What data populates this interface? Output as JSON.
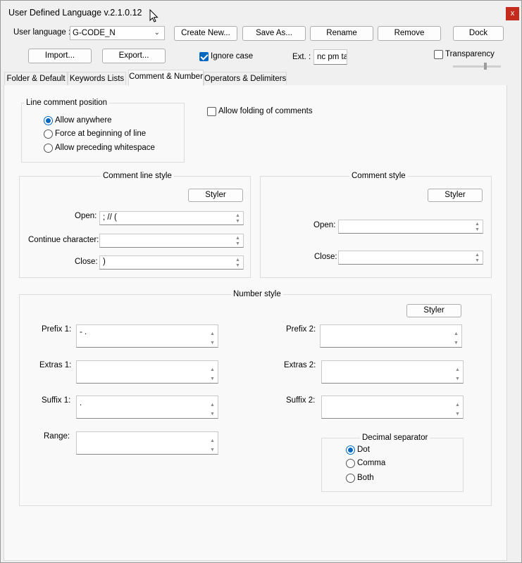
{
  "window": {
    "title": "User Defined Language v.2.1.0.12",
    "close_label": "x"
  },
  "toolbar": {
    "user_language_label": "User language :",
    "user_language_value": "G-CODE_N",
    "create_new": "Create New...",
    "save_as": "Save As...",
    "rename": "Rename",
    "remove": "Remove",
    "dock": "Dock",
    "import": "Import...",
    "export": "Export...",
    "ignore_case_label": "Ignore case",
    "ignore_case_checked": true,
    "ext_label": "Ext. :",
    "ext_value": "nc pm ta",
    "transparency_label": "Transparency",
    "transparency_checked": false
  },
  "tabs": [
    {
      "label": "Folder & Default",
      "active": false
    },
    {
      "label": "Keywords Lists",
      "active": false
    },
    {
      "label": "Comment & Number",
      "active": true
    },
    {
      "label": "Operators & Delimiters",
      "active": false
    }
  ],
  "line_comment": {
    "title": "Line comment position",
    "options": [
      "Allow anywhere",
      "Force at beginning of line",
      "Allow preceding whitespace"
    ],
    "selected": 0
  },
  "folding": {
    "label": "Allow folding of comments",
    "checked": false
  },
  "comment_line_style": {
    "title": "Comment line style",
    "styler": "Styler",
    "open_label": "Open:",
    "open_value": "; // (",
    "continue_label": "Continue character:",
    "continue_value": "",
    "close_label": "Close:",
    "close_value": ")"
  },
  "comment_style": {
    "title": "Comment style",
    "styler": "Styler",
    "open_label": "Open:",
    "open_value": "",
    "close_label": "Close:",
    "close_value": ""
  },
  "number_style": {
    "title": "Number style",
    "styler": "Styler",
    "prefix1_label": "Prefix 1:",
    "prefix1_value": "- .",
    "extras1_label": "Extras 1:",
    "extras1_value": "",
    "suffix1_label": "Suffix 1:",
    "suffix1_value": ".",
    "range_label": "Range:",
    "range_value": "",
    "prefix2_label": "Prefix 2:",
    "prefix2_value": "",
    "extras2_label": "Extras 2:",
    "extras2_value": "",
    "suffix2_label": "Suffix 2:",
    "suffix2_value": ""
  },
  "decimal_separator": {
    "title": "Decimal separator",
    "options": [
      "Dot",
      "Comma",
      "Both"
    ],
    "selected": 0
  },
  "colors": {
    "accent": "#0067c0",
    "close_button": "#c42b1c"
  }
}
